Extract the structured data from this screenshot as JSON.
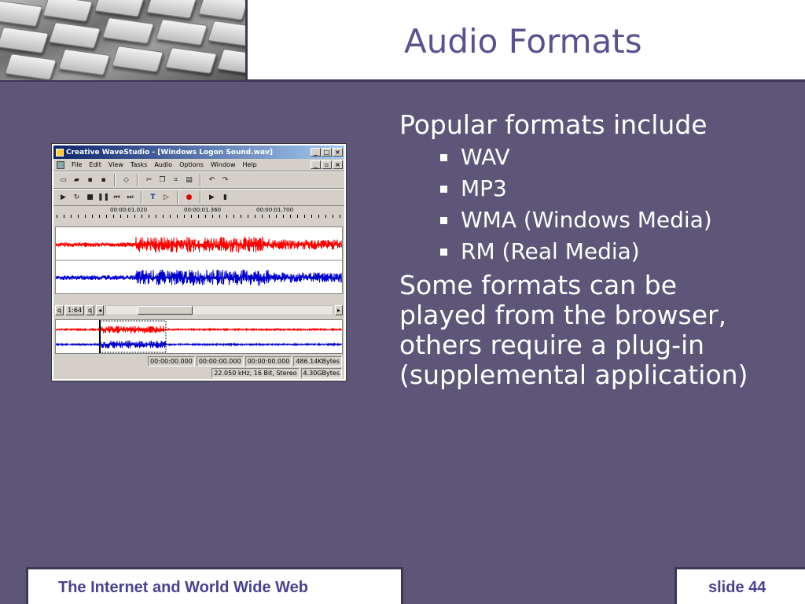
{
  "slide": {
    "title": "Audio Formats",
    "intro": "Popular formats include",
    "formats": [
      "WAV",
      "MP3",
      "WMA (Windows Media)",
      "RM (Real Media)"
    ],
    "note": "Some formats can be played from the browser, others require a plug-in (supplemental application)"
  },
  "footer": {
    "course": "The Internet and World Wide Web",
    "slide_number": "slide 44"
  },
  "app": {
    "title": "Creative WaveStudio - [Windows Logon Sound.wav]",
    "menu": [
      "File",
      "Edit",
      "View",
      "Tasks",
      "Audio",
      "Options",
      "Window",
      "Help"
    ],
    "ruler_labels": [
      "00:00:01.020",
      "00:00:01.360",
      "00:00:01.700"
    ],
    "zoom": "1:64",
    "status_times": [
      "00:00:00.000",
      "00:00:00.000",
      "00:00:00.000"
    ],
    "file_size": "486.14KBytes",
    "format": "22.050 kHz, 16 Bit, Stereo",
    "free_space": "4.30GBytes"
  },
  "colors": {
    "background": "#5e5678",
    "title": "#5a5190",
    "footer_text": "#4a4190",
    "wave_left": "#ff0000",
    "wave_right": "#0000cc"
  }
}
